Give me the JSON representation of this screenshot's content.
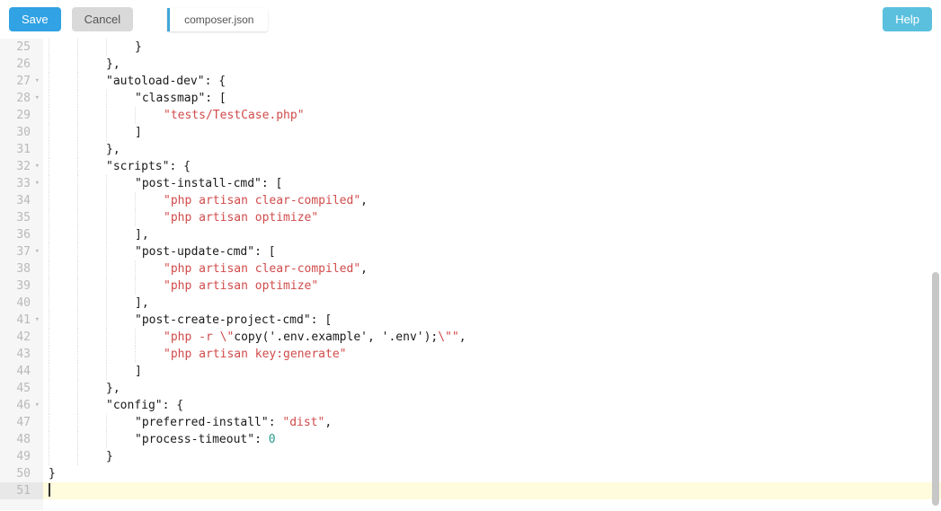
{
  "toolbar": {
    "save_label": "Save",
    "cancel_label": "Cancel",
    "help_label": "Help"
  },
  "tab": {
    "filename": "composer.json"
  },
  "gutter": {
    "start": 25,
    "end": 51,
    "fold_lines": [
      27,
      28,
      32,
      33,
      37,
      41,
      46
    ]
  },
  "code_lines": [
    {
      "n": 25,
      "indent": 3,
      "tokens": [
        {
          "t": "punc",
          "v": "}"
        }
      ]
    },
    {
      "n": 26,
      "indent": 2,
      "tokens": [
        {
          "t": "punc",
          "v": "},"
        }
      ]
    },
    {
      "n": 27,
      "indent": 2,
      "tokens": [
        {
          "t": "key",
          "v": "\"autoload-dev\""
        },
        {
          "t": "punc",
          "v": ": {"
        }
      ]
    },
    {
      "n": 28,
      "indent": 3,
      "tokens": [
        {
          "t": "key",
          "v": "\"classmap\""
        },
        {
          "t": "punc",
          "v": ": ["
        }
      ]
    },
    {
      "n": 29,
      "indent": 4,
      "tokens": [
        {
          "t": "str",
          "v": "\"tests/TestCase.php\""
        }
      ]
    },
    {
      "n": 30,
      "indent": 3,
      "tokens": [
        {
          "t": "punc",
          "v": "]"
        }
      ]
    },
    {
      "n": 31,
      "indent": 2,
      "tokens": [
        {
          "t": "punc",
          "v": "},"
        }
      ]
    },
    {
      "n": 32,
      "indent": 2,
      "tokens": [
        {
          "t": "key",
          "v": "\"scripts\""
        },
        {
          "t": "punc",
          "v": ": {"
        }
      ]
    },
    {
      "n": 33,
      "indent": 3,
      "tokens": [
        {
          "t": "key",
          "v": "\"post-install-cmd\""
        },
        {
          "t": "punc",
          "v": ": ["
        }
      ]
    },
    {
      "n": 34,
      "indent": 4,
      "tokens": [
        {
          "t": "str",
          "v": "\"php artisan clear-compiled\""
        },
        {
          "t": "punc",
          "v": ","
        }
      ]
    },
    {
      "n": 35,
      "indent": 4,
      "tokens": [
        {
          "t": "str",
          "v": "\"php artisan optimize\""
        }
      ]
    },
    {
      "n": 36,
      "indent": 3,
      "tokens": [
        {
          "t": "punc",
          "v": "],"
        }
      ]
    },
    {
      "n": 37,
      "indent": 3,
      "tokens": [
        {
          "t": "key",
          "v": "\"post-update-cmd\""
        },
        {
          "t": "punc",
          "v": ": ["
        }
      ]
    },
    {
      "n": 38,
      "indent": 4,
      "tokens": [
        {
          "t": "str",
          "v": "\"php artisan clear-compiled\""
        },
        {
          "t": "punc",
          "v": ","
        }
      ]
    },
    {
      "n": 39,
      "indent": 4,
      "tokens": [
        {
          "t": "str",
          "v": "\"php artisan optimize\""
        }
      ]
    },
    {
      "n": 40,
      "indent": 3,
      "tokens": [
        {
          "t": "punc",
          "v": "],"
        }
      ]
    },
    {
      "n": 41,
      "indent": 3,
      "tokens": [
        {
          "t": "key",
          "v": "\"post-create-project-cmd\""
        },
        {
          "t": "punc",
          "v": ": ["
        }
      ]
    },
    {
      "n": 42,
      "indent": 4,
      "tokens": [
        {
          "t": "str",
          "v": "\"php -r \\\""
        },
        {
          "t": "plain",
          "v": "copy('.env.example', '.env');"
        },
        {
          "t": "str",
          "v": "\\\"\""
        },
        {
          "t": "punc",
          "v": ","
        }
      ]
    },
    {
      "n": 43,
      "indent": 4,
      "tokens": [
        {
          "t": "str",
          "v": "\"php artisan key:generate\""
        }
      ]
    },
    {
      "n": 44,
      "indent": 3,
      "tokens": [
        {
          "t": "punc",
          "v": "]"
        }
      ]
    },
    {
      "n": 45,
      "indent": 2,
      "tokens": [
        {
          "t": "punc",
          "v": "},"
        }
      ]
    },
    {
      "n": 46,
      "indent": 2,
      "tokens": [
        {
          "t": "key",
          "v": "\"config\""
        },
        {
          "t": "punc",
          "v": ": {"
        }
      ]
    },
    {
      "n": 47,
      "indent": 3,
      "tokens": [
        {
          "t": "key",
          "v": "\"preferred-install\""
        },
        {
          "t": "punc",
          "v": ": "
        },
        {
          "t": "str",
          "v": "\"dist\""
        },
        {
          "t": "punc",
          "v": ","
        }
      ]
    },
    {
      "n": 48,
      "indent": 3,
      "tokens": [
        {
          "t": "key",
          "v": "\"process-timeout\""
        },
        {
          "t": "punc",
          "v": ": "
        },
        {
          "t": "num",
          "v": "0"
        }
      ]
    },
    {
      "n": 49,
      "indent": 2,
      "tokens": [
        {
          "t": "punc",
          "v": "}"
        }
      ]
    },
    {
      "n": 50,
      "indent": 0,
      "tokens": [
        {
          "t": "punc",
          "v": "}"
        }
      ]
    },
    {
      "n": 51,
      "indent": 0,
      "tokens": [],
      "active": true
    }
  ]
}
